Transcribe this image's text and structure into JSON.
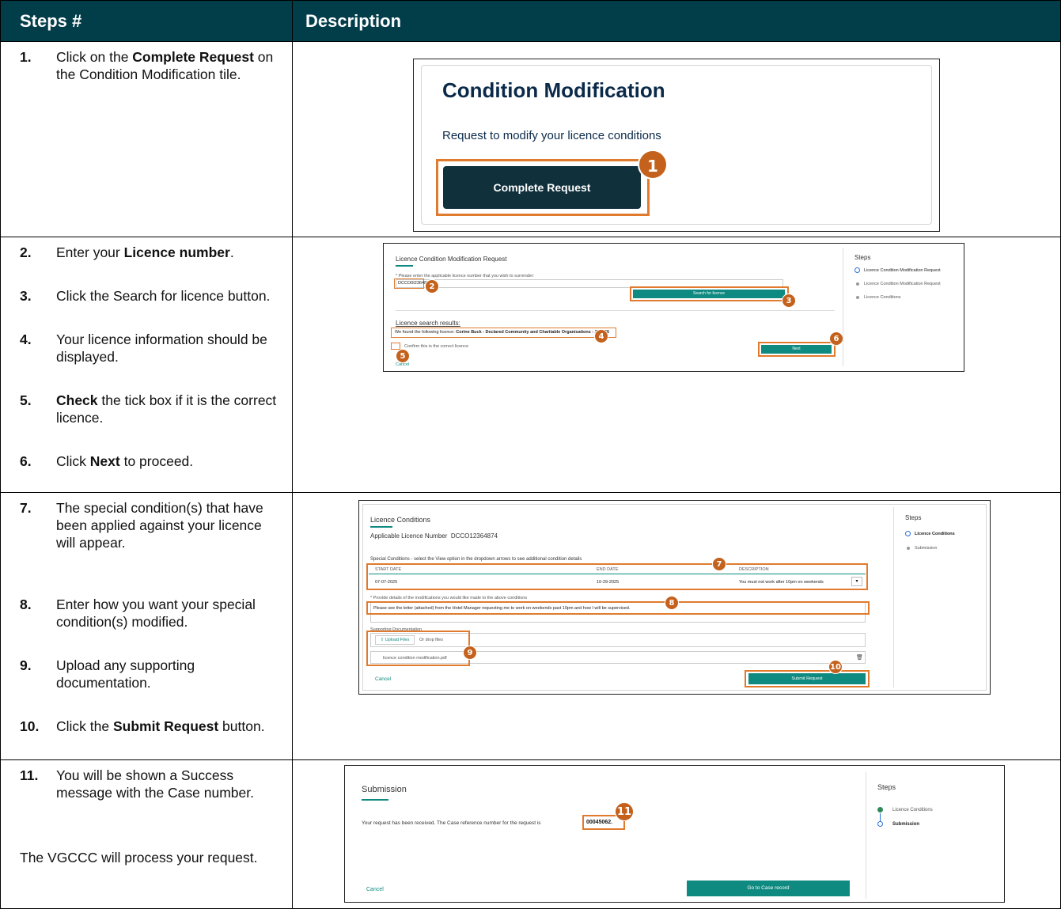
{
  "header": {
    "col1": "Steps #",
    "col2": "Description"
  },
  "steps": [
    {
      "num": "1.",
      "pre": "Click on the ",
      "bold": "Complete Request",
      "post": " on the Condition Modification tile."
    },
    {
      "num": "2.",
      "pre": "Enter your ",
      "bold": "Licence number",
      "post": "."
    },
    {
      "num": "3.",
      "pre": "Click the Search for licence button.",
      "bold": "",
      "post": ""
    },
    {
      "num": "4.",
      "pre": "Your licence information should be displayed.",
      "bold": "",
      "post": ""
    },
    {
      "num": "5.",
      "pre": "",
      "bold": "Check",
      "post": " the tick box if it is the correct licence."
    },
    {
      "num": "6.",
      "pre": "Click ",
      "bold": "Next",
      "post": " to proceed."
    },
    {
      "num": "7.",
      "pre": "The special condition(s) that have been applied against your licence will appear.",
      "bold": "",
      "post": ""
    },
    {
      "num": "8.",
      "pre": "Enter how you want your special condition(s) modified.",
      "bold": "",
      "post": ""
    },
    {
      "num": "9.",
      "pre": "Upload any supporting documentation.",
      "bold": "",
      "post": ""
    },
    {
      "num": "10.",
      "pre": "Click the ",
      "bold": "Submit Request",
      "post": " button."
    },
    {
      "num": "11.",
      "pre": "You will be shown a Success message with the Case number.",
      "bold": "",
      "post": ""
    }
  ],
  "note": "The VGCCC will process your request.",
  "shot1": {
    "title": "Condition Modification",
    "subtitle": "Request to modify your licence conditions",
    "button": "Complete Request",
    "badge": "1",
    "colors": {
      "navy": "#0b2a4a",
      "dark_button": "#10303c",
      "highlight": "#e07b2e"
    }
  },
  "shot2": {
    "title": "Licence Condition Modification Request",
    "prompt": "* Please enter the applicable licence number that you wish to surrender:",
    "licence_value": "DCCO0I2364874",
    "search_button": "Search for licence",
    "results_label": "Licence search results:",
    "result_pre": "We found the following licence: ",
    "result_bold": "Corine Buck - Declared Community and Charitable Organisations - 27/2/26",
    "confirm": "Confirm this is the correct licence",
    "cancel": "Cancel",
    "next": "Next",
    "steps_title": "Steps",
    "steps_items": [
      "Licence Condition Modification Request",
      "Licence Condition Modification Request",
      "Licence Conditions"
    ],
    "badges": [
      "2",
      "3",
      "4",
      "5",
      "6"
    ]
  },
  "shot3": {
    "title": "Licence Conditions",
    "app_label": "Applicable Licence Number",
    "app_value": "DCCO12364874",
    "special": "Special Conditions - select the View option in the dropdown arrows to see additional condition details",
    "th_start": "START DATE",
    "th_end": "END DATE",
    "th_desc": "DESCRIPTION",
    "start": "07-07-2025",
    "end": "10-29-2025",
    "desc": "You must not work after 10pm on weekends",
    "provide": "* Provide details of the modifications you would like made to the above conditions",
    "provide_text": "Please see the letter (attached) from the Hotel Manager requesting me to work on weekends past 10pm and how I will be supervised.",
    "supporting": "Supporting Documentation",
    "upload": "Upload Files",
    "drop": "Or drop files",
    "file": "licence condition modification.pdf",
    "cancel": "Cancel",
    "submit": "Submit Request",
    "steps_title": "Steps",
    "steps_items": [
      "Licence Conditions",
      "Submission"
    ],
    "badges": [
      "7",
      "8",
      "9",
      "10"
    ]
  },
  "shot4": {
    "title": "Submission",
    "message": "Your request has been received. The Case reference number for the request is",
    "case_number": "00045062.",
    "cancel": "Cancel",
    "go": "Go to Case record",
    "steps_title": "Steps",
    "steps_items": [
      "Licence Conditions",
      "Submission"
    ],
    "badge": "11"
  }
}
